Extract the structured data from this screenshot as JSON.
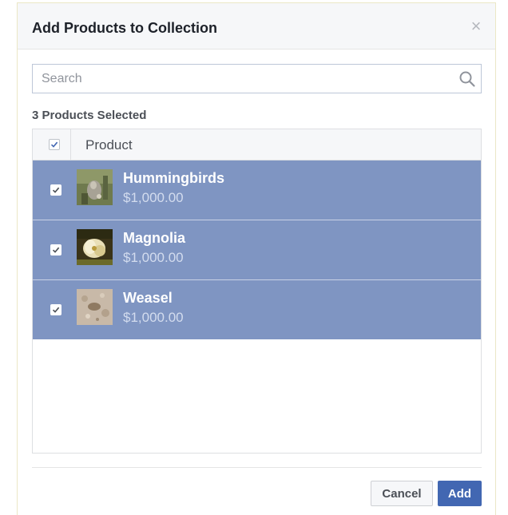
{
  "dialog": {
    "title": "Add Products to Collection",
    "close_glyph": "×"
  },
  "search": {
    "placeholder": "Search",
    "value": ""
  },
  "selection": {
    "count_label": "3 Products Selected"
  },
  "table": {
    "header_label": "Product",
    "header_checked": true,
    "rows": [
      {
        "name": "Hummingbirds",
        "price": "$1,000.00",
        "checked": true,
        "thumb_icon": "hummingbirds-thumbnail"
      },
      {
        "name": "Magnolia",
        "price": "$1,000.00",
        "checked": true,
        "thumb_icon": "magnolia-thumbnail"
      },
      {
        "name": "Weasel",
        "price": "$1,000.00",
        "checked": true,
        "thumb_icon": "weasel-thumbnail"
      }
    ]
  },
  "footer": {
    "cancel_label": "Cancel",
    "add_label": "Add"
  },
  "colors": {
    "selected_row": "#7f95c2",
    "primary_button": "#4267b2",
    "header_bg": "#f6f7f9"
  }
}
